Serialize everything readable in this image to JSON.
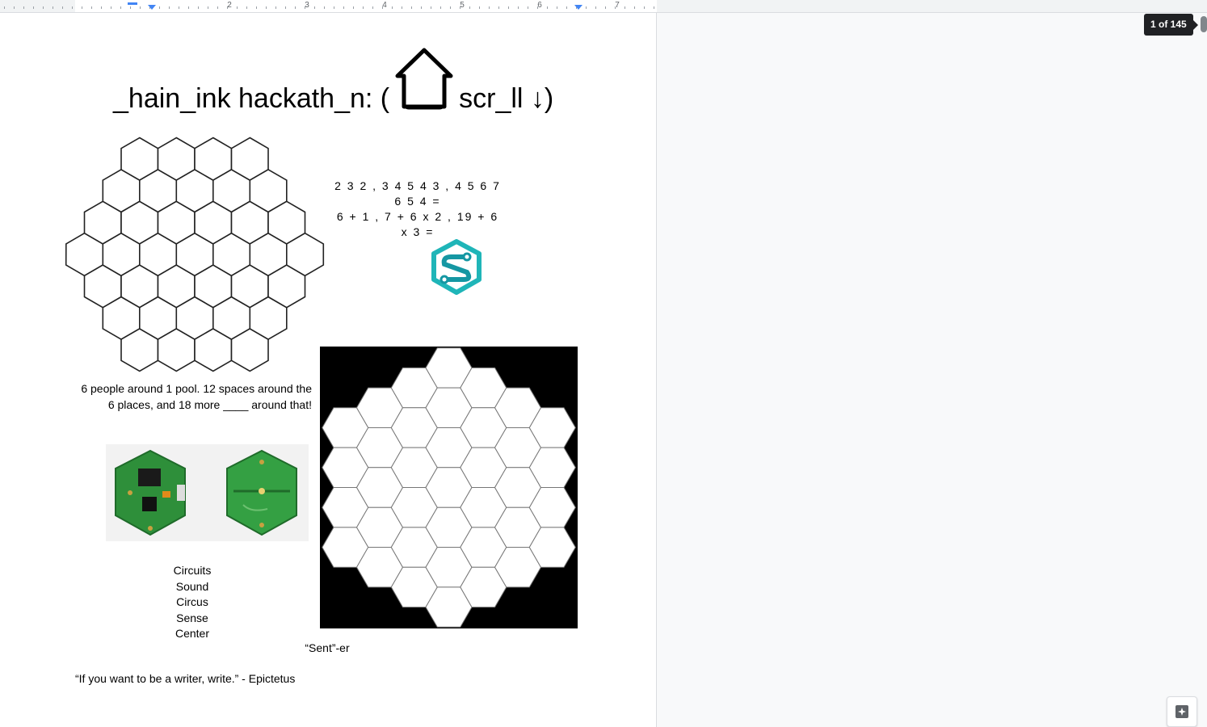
{
  "ruler": {
    "numbers": [
      "2",
      "3",
      "4",
      "5",
      "6",
      "7"
    ]
  },
  "document": {
    "title_left": "_hain_ink hackath_n: (",
    "title_right": "scr_ll ↓)",
    "sequence_line1": "2 3 2 , 3 4 5 4 3 , 4 5 6 7 6 5 4 =",
    "sequence_line2": "6 + 1 , 7 + 6 x 2 , 19 + 6 x 3  =",
    "pool_text": "6 people around 1 pool. 12 spaces around the 6 places, and 18 more ____ around that!",
    "words": [
      "Circuits",
      "Sound",
      "Circus",
      "Sense",
      "Center"
    ],
    "grid_caption": "“Sent”-er",
    "quote": "“If you want to be a writer, write.” - Epictetus"
  },
  "page_indicator": "1 of 145",
  "icons": {
    "title_icon": "house-outline-icon",
    "logo": "s-circuit-logo",
    "explore": "explore-sparkle-icon"
  },
  "colors": {
    "accent": "#4285f4",
    "logo_teal": "#1fb5b8",
    "pcb_green": "#2e8f3a"
  }
}
